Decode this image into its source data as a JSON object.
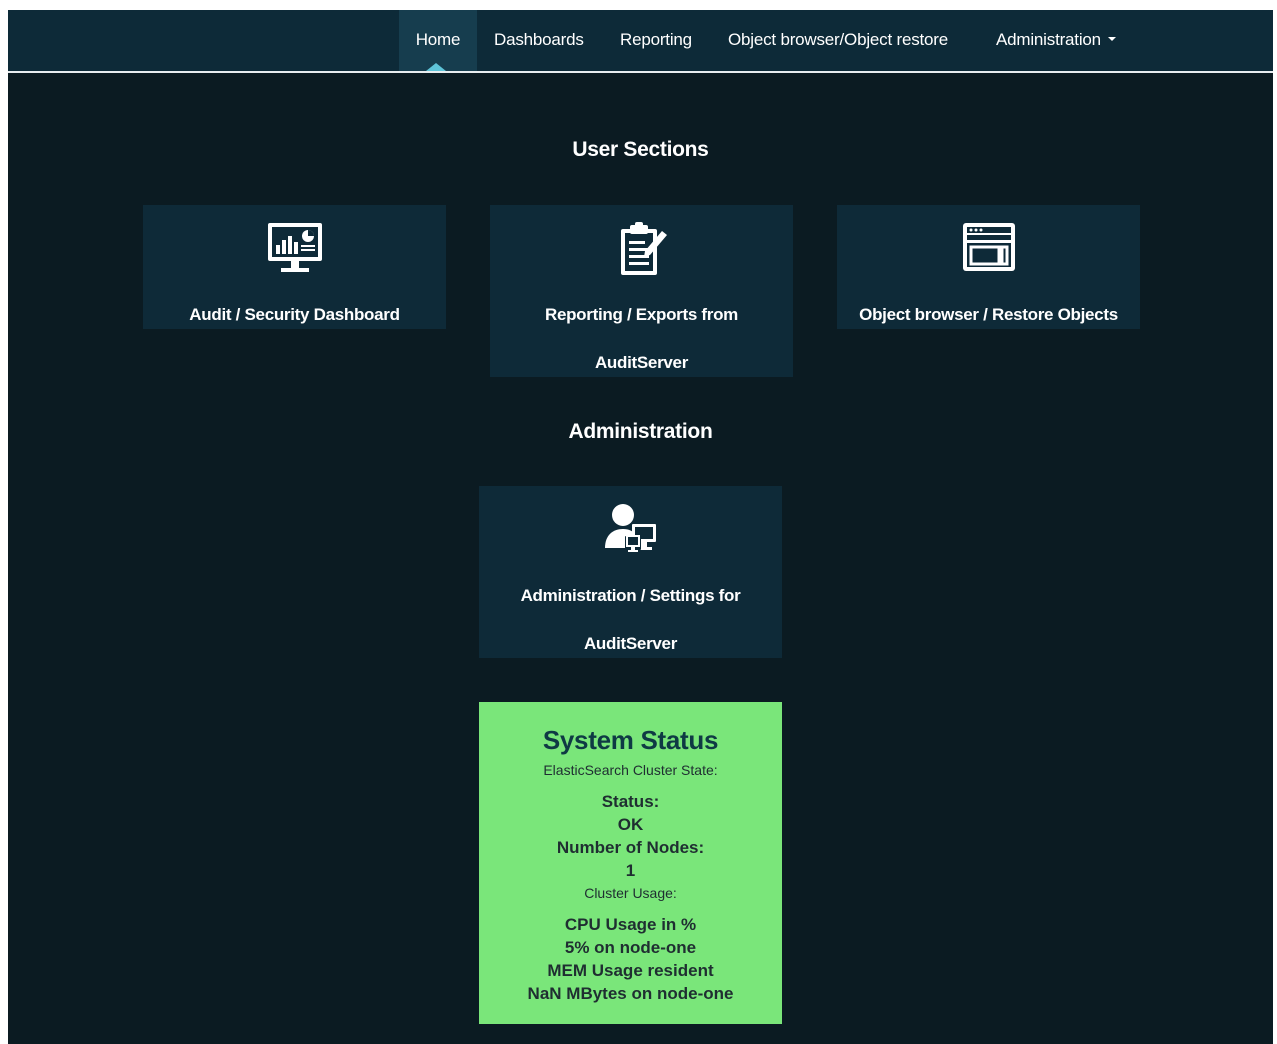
{
  "nav": {
    "items": [
      {
        "label": "Home",
        "active": true
      },
      {
        "label": "Dashboards"
      },
      {
        "label": "Reporting"
      },
      {
        "label": "Object browser/Object restore"
      },
      {
        "label": "Administration",
        "dropdown": true
      }
    ]
  },
  "user_sections": {
    "title": "User Sections",
    "tiles": [
      {
        "label": "Audit / Security Dashboard",
        "icon": "monitor-chart-icon"
      },
      {
        "label_line1": "Reporting / Exports from",
        "label_line2": "AuditServer",
        "icon": "clipboard-edit-icon"
      },
      {
        "label": "Object browser / Restore Objects",
        "icon": "browser-window-icon"
      }
    ]
  },
  "administration": {
    "title": "Administration",
    "tile": {
      "label_line1": "Administration / Settings for",
      "label_line2": "AuditServer",
      "icon": "user-computer-icon"
    }
  },
  "system_status": {
    "title": "System Status",
    "cluster_state_label": "ElasticSearch Cluster State:",
    "status_label": "Status:",
    "status_value": "OK",
    "nodes_label": "Number of Nodes:",
    "nodes_value": "1",
    "cluster_usage_label": "Cluster Usage:",
    "cpu_label": "CPU Usage in %",
    "cpu_value": "5% on node-one",
    "mem_label": "MEM Usage resident",
    "mem_value": "NaN MBytes on node-one"
  },
  "colors": {
    "background": "#0b1b22",
    "navbar": "#0d2a38",
    "tile": "#0e2a38",
    "status_ok": "#7ae67a",
    "active_indicator": "#5ec4d8"
  }
}
